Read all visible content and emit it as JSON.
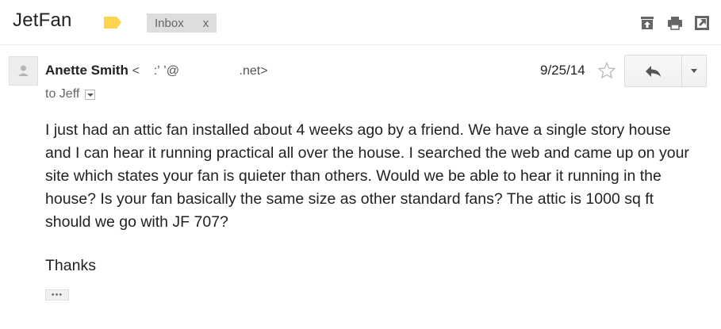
{
  "thread": {
    "subject": "JetFan",
    "label_chip": "Inbox",
    "label_chip_remove": "x"
  },
  "colors": {
    "important_marker": "#ffd54f",
    "chip_background": "#dddddd",
    "text": "#222222",
    "muted_text": "#666666"
  },
  "icons": {
    "label": "important-marker-icon",
    "archive": "archive-icon",
    "print": "print-icon",
    "new_window": "open-in-new-window-icon",
    "avatar": "person-icon",
    "star": "star-icon",
    "reply": "reply-icon",
    "more": "chevron-down-icon",
    "to_details": "chevron-down-icon",
    "trimmed": "ellipsis-icon"
  },
  "message": {
    "sender_name": "Anette Smith",
    "sender_email": "<    :’ ’@                 .net>",
    "to_line": "to Jeff",
    "date": "9/25/14",
    "body": "I just had an attic fan installed about 4 weeks ago by a friend.  We have a single story house and  I can hear it running  practical all over the house.  I searched the web and came up on your site which states your fan is quieter than others.  Would we be able to hear it running in the house?  Is your fan basically the same size as other standard fans?  The attic is 1000 sq ft should we go with JF 707?",
    "closing": "Thanks",
    "trimmed_indicator": "•••"
  }
}
